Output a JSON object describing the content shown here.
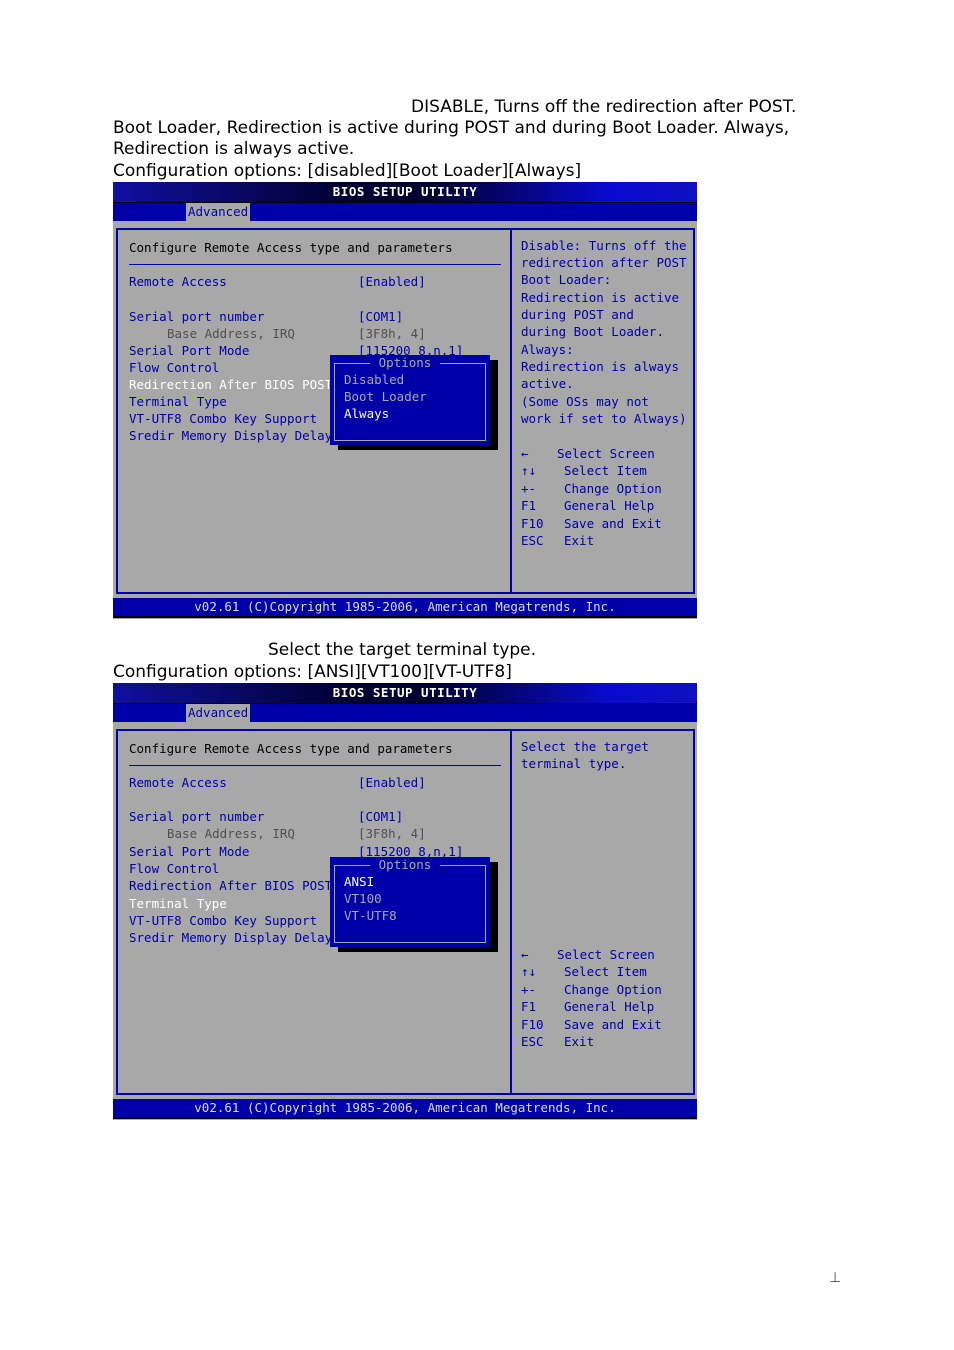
{
  "section1": {
    "description_lines": [
      "DISABLE, Turns off the redirection after POST.",
      "Boot Loader, Redirection is active during POST and during Boot Loader. Always,",
      "Redirection is always active.",
      "Configuration options: [disabled][Boot Loader][Always]"
    ],
    "bios": {
      "title": "BIOS SETUP UTILITY",
      "active_tab": "Advanced",
      "panel_title": "Configure Remote Access type and parameters",
      "settings": [
        {
          "label": "Remote Access",
          "value": "[Enabled]"
        },
        {
          "label": "Serial port number",
          "value": "[COM1]"
        },
        {
          "label": "Base Address, IRQ",
          "value": "[3F8h, 4]"
        },
        {
          "label": "Serial Port Mode",
          "value": "[115200 8,n,1]"
        },
        {
          "label": "Flow Control",
          "value": ""
        },
        {
          "label": "Redirection After BIOS POST",
          "value": ""
        },
        {
          "label": "Terminal Type",
          "value": ""
        },
        {
          "label": "VT-UTF8 Combo Key Support",
          "value": ""
        },
        {
          "label": "Sredir Memory Display Delay",
          "value": ""
        }
      ],
      "selected_setting": "Redirection After BIOS POST",
      "popup": {
        "title": "Options",
        "options": [
          "Disabled",
          "Boot Loader",
          "Always"
        ],
        "highlighted": "Always"
      },
      "help_lines": [
        "Disable: Turns off the",
        "redirection after POST",
        "Boot Loader:",
        "Redirection is active",
        "during POST and",
        "during Boot Loader.",
        "Always:",
        "Redirection is always",
        "active.",
        "(Some OSs may not",
        "work if set to Always)"
      ],
      "keys": [
        {
          "key": "←",
          "desc": "Select Screen"
        },
        {
          "key": "↑↓",
          "desc": "Select Item"
        },
        {
          "key": "+-",
          "desc": "Change Option"
        },
        {
          "key": "F1",
          "desc": "General Help"
        },
        {
          "key": "F10",
          "desc": "Save and Exit"
        },
        {
          "key": "ESC",
          "desc": "Exit"
        }
      ],
      "footer": "v02.61 (C)Copyright 1985-2006, American Megatrends, Inc."
    }
  },
  "section2": {
    "description_lines": [
      "Select the target terminal type.",
      "Configuration options: [ANSI][VT100][VT-UTF8]"
    ],
    "bios": {
      "title": "BIOS SETUP UTILITY",
      "active_tab": "Advanced",
      "panel_title": "Configure Remote Access type and parameters",
      "settings": [
        {
          "label": "Remote Access",
          "value": "[Enabled]"
        },
        {
          "label": "Serial port number",
          "value": "[COM1]"
        },
        {
          "label": "Base Address, IRQ",
          "value": "[3F8h, 4]"
        },
        {
          "label": "Serial Port Mode",
          "value": "[115200 8,n,1]"
        },
        {
          "label": "Flow Control",
          "value": ""
        },
        {
          "label": "Redirection After BIOS POST",
          "value": ""
        },
        {
          "label": "Terminal Type",
          "value": ""
        },
        {
          "label": "VT-UTF8 Combo Key Support",
          "value": ""
        },
        {
          "label": "Sredir Memory Display Delay",
          "value": ""
        }
      ],
      "selected_setting": "Terminal Type",
      "popup": {
        "title": "Options",
        "options": [
          "ANSI",
          "VT100",
          "VT-UTF8"
        ],
        "highlighted": "ANSI"
      },
      "help_lines": [
        "Select the target",
        "terminal type."
      ],
      "keys": [
        {
          "key": "←",
          "desc": "Select Screen"
        },
        {
          "key": "↑↓",
          "desc": "Select Item"
        },
        {
          "key": "+-",
          "desc": "Change Option"
        },
        {
          "key": "F1",
          "desc": "General Help"
        },
        {
          "key": "F10",
          "desc": "Save and Exit"
        },
        {
          "key": "ESC",
          "desc": "Exit"
        }
      ],
      "footer": "v02.61 (C)Copyright 1985-2006, American Megatrends, Inc."
    }
  },
  "page_mark": "⊥"
}
